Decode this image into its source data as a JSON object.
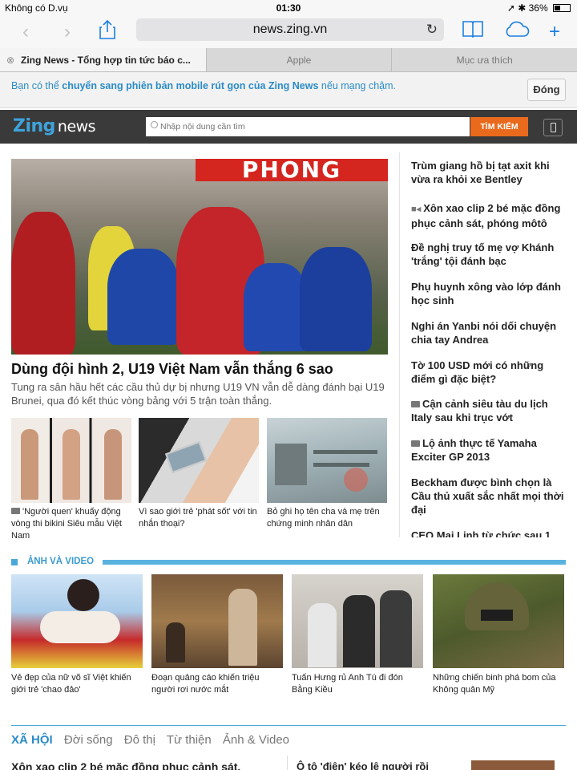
{
  "status_bar": {
    "carrier": "Không có D.vụ",
    "time": "01:30",
    "battery": "36%"
  },
  "toolbar": {
    "url": "news.zing.vn"
  },
  "tabs": [
    {
      "label": "Zing News - Tổng hợp tin tức báo c..."
    },
    {
      "label": "Apple"
    },
    {
      "label": "Mục ưa thích"
    }
  ],
  "notice": {
    "prefix": "Bạn có thể ",
    "link": "chuyển sang phiên bản mobile rút gọn của Zing News",
    "suffix": " nếu mạng chậm.",
    "close_label": "Đóng"
  },
  "header": {
    "logo_zing": "Zing",
    "logo_news": "news",
    "search_placeholder": "Nhập nội dung cần tìm",
    "search_button": "TÌM KIẾM"
  },
  "hero": {
    "banner_text": "PHONG",
    "title": "Dùng đội hình 2, U19 Việt Nam vẫn thắng 6 sao",
    "summary": "Tung ra sân hầu hết các cầu thủ dự bị nhưng U19 VN vẫn dễ dàng đánh bại U19 Brunei, qua đó kết thúc vòng bảng với 5 trận toàn thắng."
  },
  "cards": [
    {
      "caption": "'Người quen' khuấy động vòng thi bikini Siêu mẫu Việt Nam",
      "has_camera": true
    },
    {
      "caption": "Vì sao giới trẻ 'phát sốt' với tin nhắn thoại?",
      "has_camera": false
    },
    {
      "caption": "Bỏ ghi họ tên cha và mẹ trên chứng minh nhân dân",
      "has_camera": false
    }
  ],
  "headlines": [
    {
      "text": "Trùm giang hồ bị tạt axit khi vừa ra khỏi xe Bentley",
      "icon": ""
    },
    {
      "text": "Xôn xao clip 2 bé mặc đồng phục cảnh sát, phóng môtô",
      "icon": "video-icon"
    },
    {
      "text": "Đề nghị truy tố mẹ vợ Khánh 'trắng' tội đánh bạc",
      "icon": ""
    },
    {
      "text": "Phụ huynh xông vào lớp đánh học sinh",
      "icon": ""
    },
    {
      "text": "Nghi án Yanbi nói dối chuyện chia tay Andrea",
      "icon": ""
    },
    {
      "text": "Tờ 100 USD mới có những điểm gì đặc biệt?",
      "icon": ""
    },
    {
      "text": "Cận cảnh siêu tàu du lịch Italy sau khi trục vớt",
      "icon": "camera-icon"
    },
    {
      "text": "Lộ ảnh thực tế Yamaha Exciter GP 2013",
      "icon": "camera-icon"
    },
    {
      "text": "Beckham được bình chọn là Cầu thủ xuất sắc nhất mọi thời đại",
      "icon": ""
    },
    {
      "text": "CEO Mai Linh từ chức sau 1",
      "icon": ""
    }
  ],
  "video_section": {
    "title": "ẢNH VÀ VIDEO",
    "items": [
      {
        "caption": "Vẻ đẹp của nữ võ sĩ Việt khiến giới trẻ 'chao đảo'"
      },
      {
        "caption": "Đoạn quảng cáo khiến triệu người rơi nước mắt"
      },
      {
        "caption": "Tuấn Hưng rủ Anh Tú đi đón Bằng Kiều"
      },
      {
        "caption": "Những chiến binh phá bom của Không quân Mỹ"
      }
    ]
  },
  "xa_hoi": {
    "nav": [
      "XÃ HỘI",
      "Đời sống",
      "Đô thị",
      "Từ thiện",
      "Ảnh & Video"
    ],
    "story_left": "Xôn xao clip 2 bé mặc đồng phục cảnh sát,",
    "story_right": "Ô tô 'điên' kéo lê người rồi"
  },
  "colors": {
    "accent": "#2a8bc7",
    "header_bg": "#3a3a3a",
    "search_button": "#ea6a1d",
    "ios_blue": "#1a7fe0"
  }
}
